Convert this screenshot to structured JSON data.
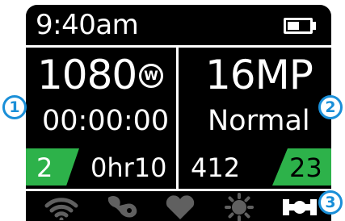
{
  "status": {
    "time": "9:40am",
    "battery_level": 0.55
  },
  "left_panel": {
    "video_resolution": "1080",
    "mode_badge": "W",
    "recording_time": "00:00:00",
    "video_count": "2",
    "remaining_time": "0hr10"
  },
  "right_panel": {
    "photo_resolution": "16MP",
    "photo_mode": "Normal",
    "photos_remaining": "412",
    "photo_count": "23"
  },
  "icons": [
    "wifi-icon",
    "ant-sensor-icon",
    "heart-rate-icon",
    "sun-brightness-icon",
    "tempe-sensor-icon"
  ],
  "callouts": [
    "1",
    "2",
    "3"
  ],
  "colors": {
    "accent_green": "#2db24a",
    "icon_inactive": "#606060",
    "callout_blue": "#1a8fd8",
    "background": "#000000"
  }
}
